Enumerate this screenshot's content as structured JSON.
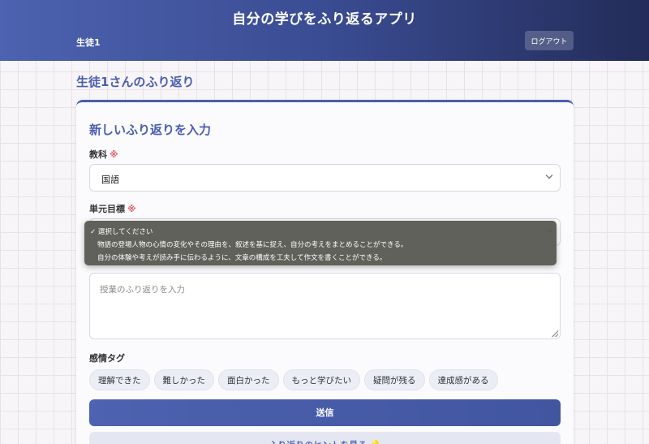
{
  "header": {
    "app_title": "自分の学びをふり返るアプリ",
    "user_name": "生徒1",
    "logout_label": "ログアウト"
  },
  "page": {
    "heading": "生徒1さんのふり返り"
  },
  "form": {
    "title": "新しいふり返りを入力",
    "required_mark": "※",
    "subject": {
      "label": "教科",
      "value": "国語"
    },
    "unit_goal": {
      "label": "単元目標",
      "options": [
        "✓ 選択してください",
        "物語の登場人物の心情の変化やその理由を、叙述を基に捉え、自分の考えをまとめることができる。",
        "自分の体験や考えが読み手に伝わるように、文章の構成を工夫して作文を書くことができる。"
      ]
    },
    "reflection": {
      "placeholder": "授業のふり返りを入力"
    },
    "emotion_tags": {
      "label": "感情タグ",
      "tags": [
        "理解できた",
        "難しかった",
        "面白かった",
        "もっと学びたい",
        "疑問が残る",
        "達成感がある"
      ]
    },
    "submit_label": "送信",
    "hint_label": "ふり返りのヒントを見る 💡"
  },
  "colors": {
    "accent": "#4a5fae",
    "header_dark": "#232c59",
    "required": "#e05a5a"
  }
}
